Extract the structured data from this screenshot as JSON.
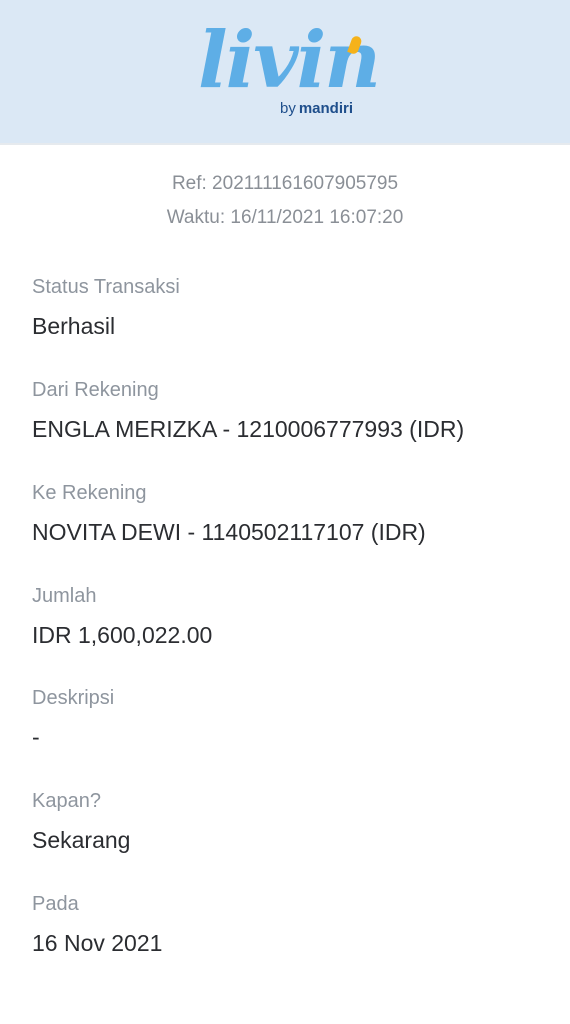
{
  "header": {
    "logo_wordmark": "livin",
    "logo_by": "by",
    "logo_brand": "mandiri"
  },
  "meta": {
    "ref": "Ref: 202111161607905795",
    "time": "Waktu: 16/11/2021 16:07:20"
  },
  "fields": [
    {
      "label": "Status Transaksi",
      "value": "Berhasil"
    },
    {
      "label": "Dari Rekening",
      "value": "ENGLA MERIZKA - 1210006777993 (IDR)"
    },
    {
      "label": "Ke Rekening",
      "value": "NOVITA DEWI - 1140502117107 (IDR)"
    },
    {
      "label": "Jumlah",
      "value": "IDR 1,600,022.00"
    },
    {
      "label": "Deskripsi",
      "value": "-"
    },
    {
      "label": "Kapan?",
      "value": "Sekarang"
    },
    {
      "label": "Pada",
      "value": "16 Nov 2021"
    }
  ]
}
